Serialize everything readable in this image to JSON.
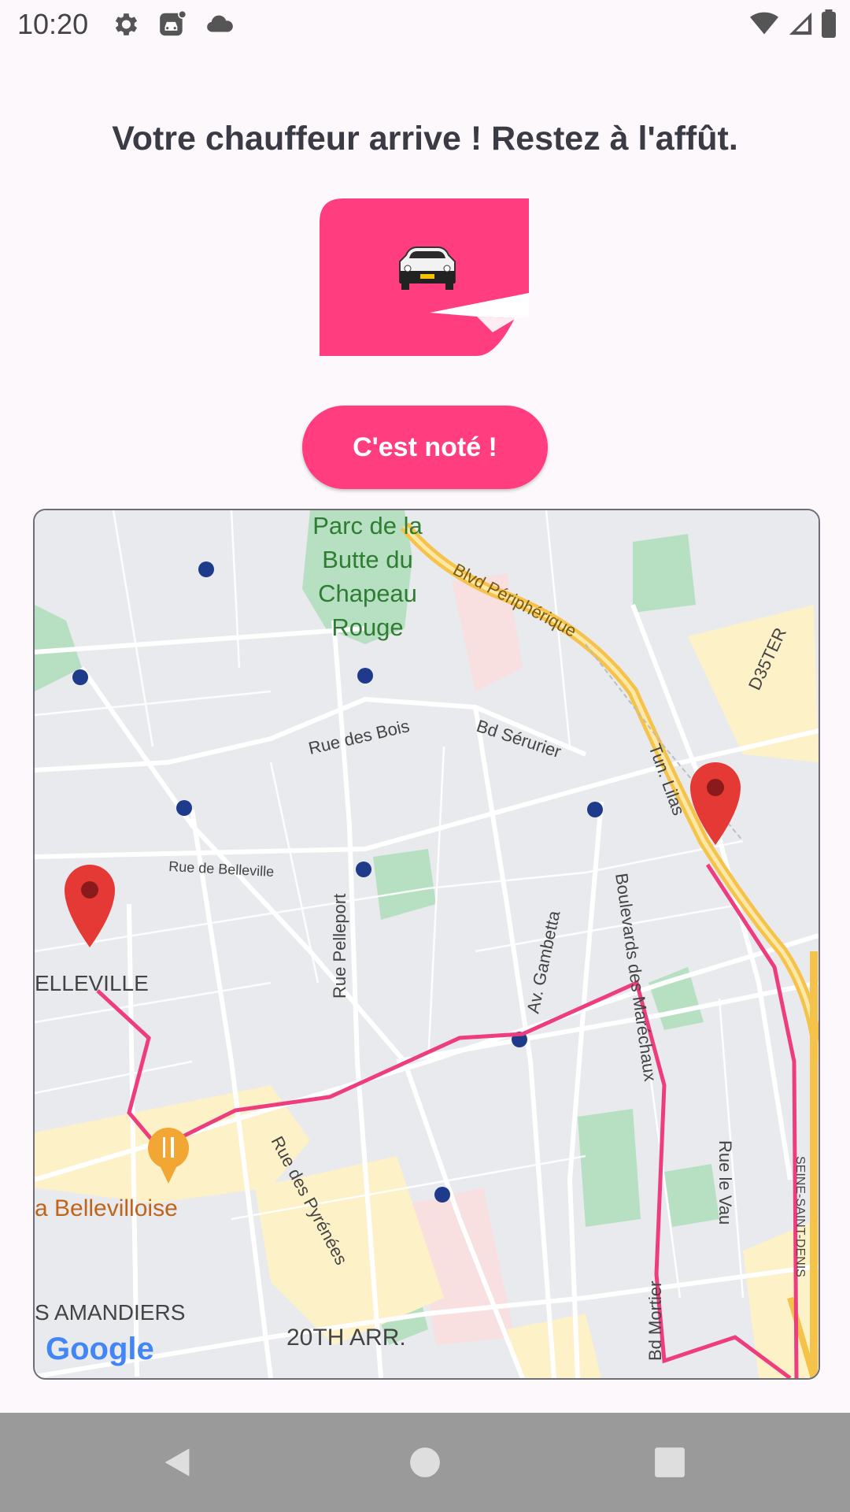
{
  "status_bar": {
    "time": "10:20",
    "left_icons": [
      "settings-icon",
      "car-notification-icon",
      "cloud-icon"
    ],
    "right_icons": [
      "wifi-icon",
      "cell-signal-icon",
      "battery-icon"
    ]
  },
  "headline": "Votre chauffeur arrive ! Restez à l'affût.",
  "illustration": {
    "icon": "car-icon",
    "color": "#ff3d7f"
  },
  "confirm_button": {
    "label": "C'est noté !",
    "color": "#ff3d7f"
  },
  "map": {
    "route_color": "#ee3d7f",
    "labels": {
      "park": [
        "Parc de la",
        "Butte du",
        "Chapeau",
        "Rouge"
      ],
      "blvd_peripherique": "Blvd Périphérique",
      "d35ter": "D35TER",
      "rue_des_bois": "Rue des Bois",
      "bd_serurier": "Bd Sérurier",
      "tun_lilas": "Tun. Lilas",
      "rue_de_belleville": "Rue de Belleville",
      "rue_pelleport": "Rue Pelleport",
      "av_gambetta": "Av. Gambetta",
      "bd_marechaux": "Boulevards des Maréchaux",
      "belleville": "ELLEVILLE",
      "bellevilloise": "a Bellevilloise",
      "rue_pyrenees": "Rue des Pyrénées",
      "rue_le_vau": "Rue le Vau",
      "seine_saint_denis": "SEINE-SAINT-DENIS",
      "bd_mortier": "Bd Mortier",
      "amandiers": "S AMANDIERS",
      "arr20": "20TH ARR.",
      "google": "Google"
    }
  },
  "nav": {
    "icons": [
      "back-icon",
      "home-icon",
      "recents-icon"
    ]
  }
}
